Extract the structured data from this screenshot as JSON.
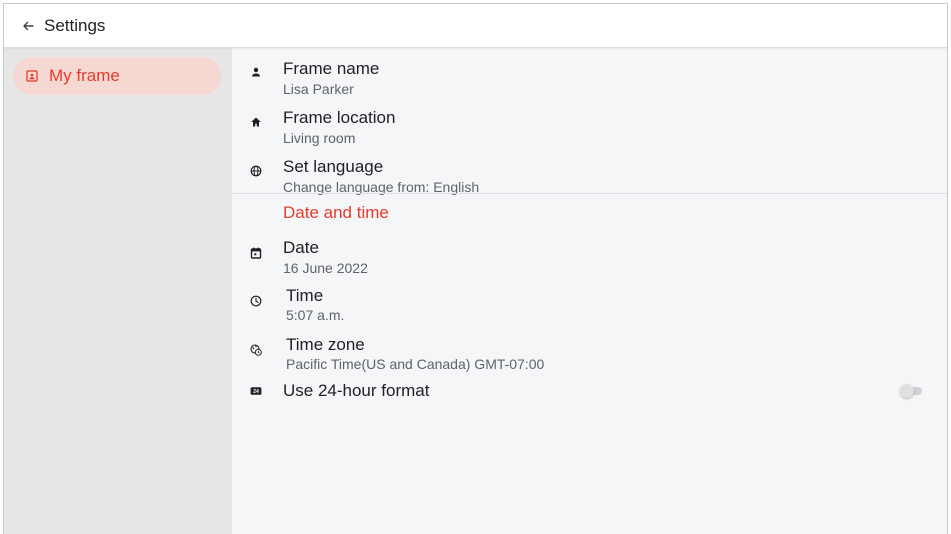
{
  "header": {
    "title": "Settings",
    "back_icon": "arrow-left-icon"
  },
  "sidebar": {
    "items": [
      {
        "label": "My frame",
        "icon": "frame-icon",
        "selected": true
      }
    ]
  },
  "main": {
    "general": [
      {
        "title": "Frame name",
        "subtitle": "Lisa Parker",
        "icon": "person-icon"
      },
      {
        "title": "Frame location",
        "subtitle": "Living room",
        "icon": "home-icon"
      },
      {
        "title": "Set language",
        "subtitle": "Change language from: English",
        "icon": "globe-icon"
      }
    ],
    "date_time": {
      "header": "Date and time",
      "items": [
        {
          "title": "Date",
          "subtitle": "16 June 2022",
          "icon": "calendar-icon"
        },
        {
          "title": "Time",
          "subtitle": "5:07 a.m.",
          "icon": "clock-icon"
        },
        {
          "title": "Time zone",
          "subtitle": "Pacific Time(US and Canada) GMT-07:00",
          "icon": "timezone-icon"
        },
        {
          "title": "Use 24-hour format",
          "icon": "hour-24-icon",
          "toggle_on": false
        }
      ]
    }
  },
  "colors": {
    "accent": "#e53b2c",
    "selected_bg": "#f6d8d3",
    "sidebar_bg": "#e6e6e6",
    "main_bg": "#f5f6f8"
  }
}
